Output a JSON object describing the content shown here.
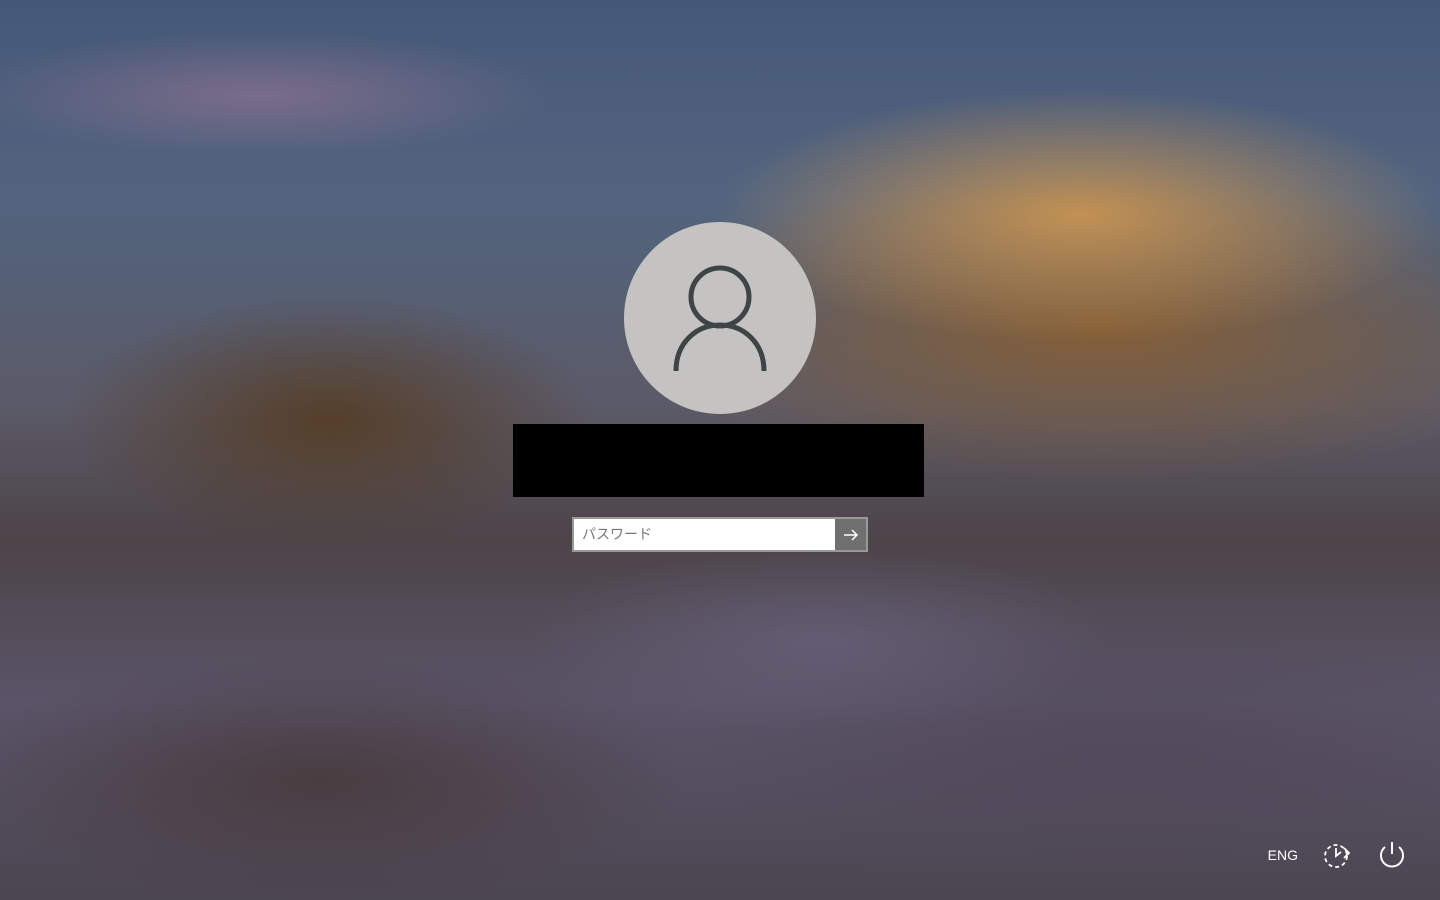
{
  "login": {
    "avatar_icon": "user-icon",
    "password_placeholder": "パスワード",
    "submit_icon": "arrow-right-icon"
  },
  "bottom_bar": {
    "language_label": "ENG",
    "accessibility_icon": "ease-of-access-icon",
    "power_icon": "power-icon"
  }
}
